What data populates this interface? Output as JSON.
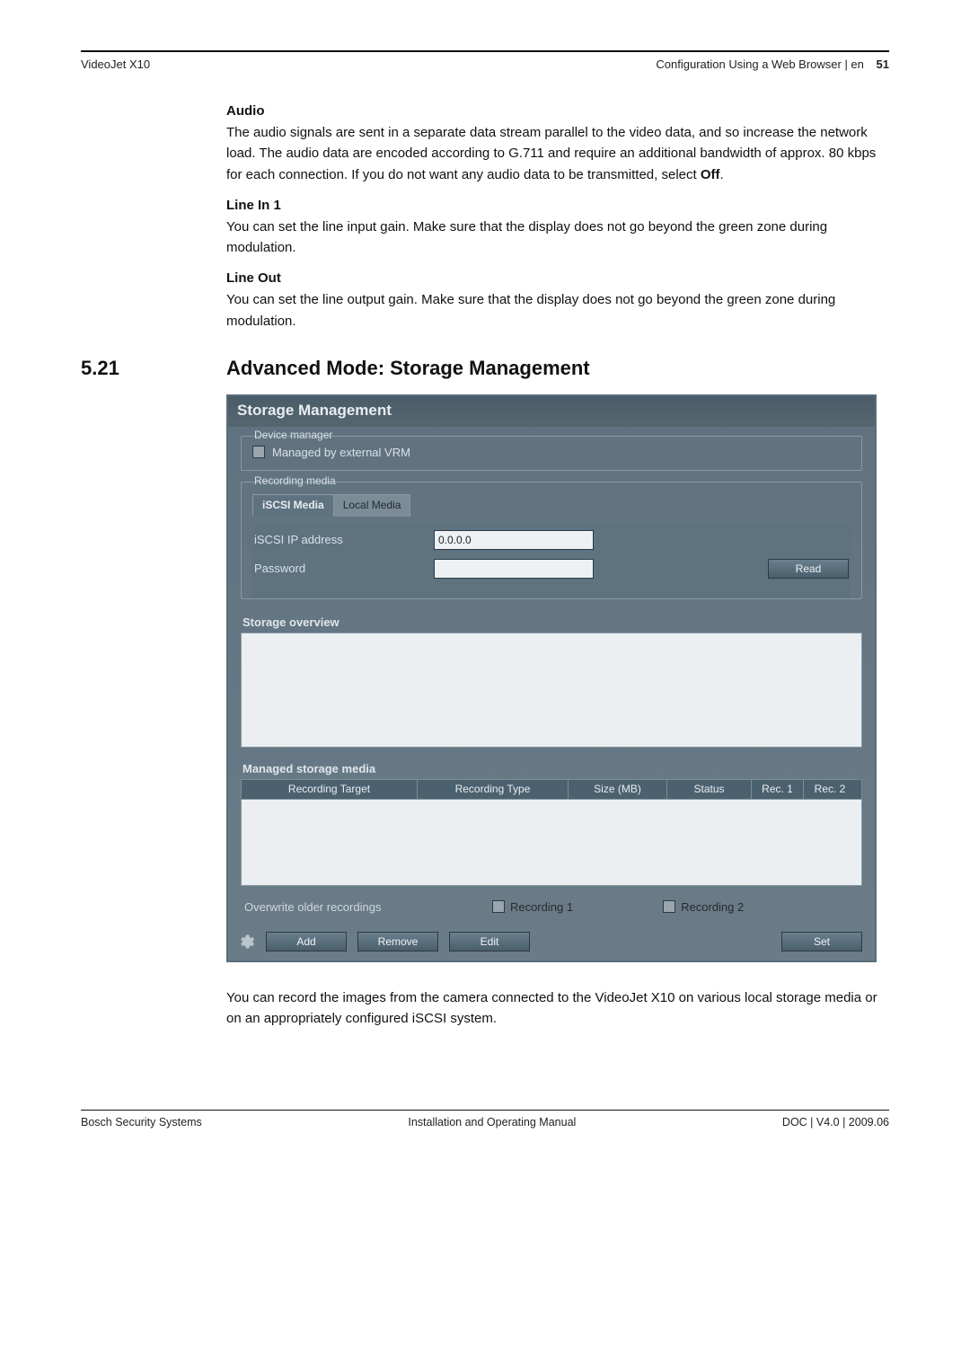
{
  "runhead": {
    "left": "VideoJet X10",
    "right_label": "Configuration Using a Web Browser | en",
    "page_number": "51"
  },
  "sections": {
    "audio": {
      "heading": "Audio",
      "para_pre": "The audio signals are sent in a separate data stream parallel to the video data, and so increase the network load. The audio data are encoded according to G.711 and require an additional bandwidth of approx. 80 kbps for each connection. If you do not want any audio data to be transmitted, select ",
      "para_bold": "Off",
      "para_post": "."
    },
    "linein": {
      "heading": "Line In 1",
      "para": "You can set the line input gain. Make sure that the display does not go beyond the green zone during modulation."
    },
    "lineout": {
      "heading": "Line Out",
      "para": "You can set the line output gain. Make sure that the display does not go beyond the green zone during modulation."
    }
  },
  "section521": {
    "number": "5.21",
    "title": "Advanced Mode: Storage Management"
  },
  "panel": {
    "title": "Storage Management",
    "device_manager": {
      "legend": "Device manager",
      "checkbox_label": "Managed by external VRM"
    },
    "recording_media": {
      "legend": "Recording media",
      "tabs": {
        "iscsi": "iSCSI Media",
        "local": "Local Media"
      },
      "iscsi_ip_label": "iSCSI IP address",
      "iscsi_ip_value": "0.0.0.0",
      "password_label": "Password",
      "password_value": "",
      "read_button": "Read"
    },
    "storage_overview_header": "Storage overview",
    "managed_media_header": "Managed storage media",
    "table": {
      "cols": {
        "target": "Recording Target",
        "type": "Recording Type",
        "size": "Size (MB)",
        "status": "Status",
        "rec1": "Rec. 1",
        "rec2": "Rec. 2"
      }
    },
    "overwrite": {
      "label": "Overwrite older recordings",
      "opt1": "Recording 1",
      "opt2": "Recording 2"
    },
    "buttons": {
      "add": "Add",
      "remove": "Remove",
      "edit": "Edit",
      "set": "Set"
    }
  },
  "after_text": "You can record the images from the camera connected to the VideoJet X10 on various local storage media or on an appropriately configured iSCSI system.",
  "footer": {
    "left": "Bosch Security Systems",
    "center": "Installation and Operating Manual",
    "right": "DOC | V4.0 | 2009.06"
  }
}
